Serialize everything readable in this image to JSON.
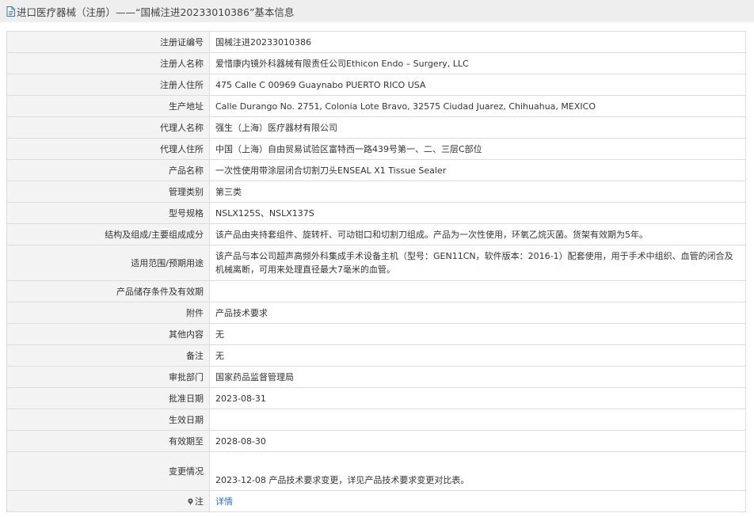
{
  "header": {
    "title": "进口医疗器械（注册）——“国械注进20233010386”基本信息"
  },
  "rows": [
    {
      "label": "注册证编号",
      "value": "国械注进20233010386"
    },
    {
      "label": "注册人名称",
      "value": "爱惜康内镜外科器械有限责任公司Ethicon Endo – Surgery, LLC"
    },
    {
      "label": "注册人住所",
      "value": "475 Calle C 00969 Guaynabo PUERTO RICO USA"
    },
    {
      "label": "生产地址",
      "value": "Calle Durango No. 2751, Colonia Lote Bravo, 32575 Ciudad Juarez, Chihuahua, MEXICO"
    },
    {
      "label": "代理人名称",
      "value": "强生（上海）医疗器材有限公司"
    },
    {
      "label": "代理人住所",
      "value": "中国（上海）自由贸易试验区富特西一路439号第一、二、三层C部位"
    },
    {
      "label": "产品名称",
      "value": "一次性使用带涂层闭合切割刀头ENSEAL X1 Tissue Sealer"
    },
    {
      "label": "管理类别",
      "value": "第三类"
    },
    {
      "label": "型号规格",
      "value": "NSLX125S、NSLX137S"
    },
    {
      "label": "结构及组成/主要组成成分",
      "value": "该产品由夹持套组件、旋转杆、可动钳口和切割刀组成。产品为一次性使用，环氧乙烷灭菌。货架有效期为5年。"
    },
    {
      "label": "适用范围/预期用途",
      "value": "该产品与本公司超声高频外科集成手术设备主机（型号：GEN11CN，软件版本：2016-1）配套使用，用于手术中组织、血管的闭合及机械离断，可用来处理直径最大7毫米的血管。"
    },
    {
      "label": "产品储存条件及有效期",
      "value": ""
    },
    {
      "label": "附件",
      "value": "产品技术要求"
    },
    {
      "label": "其他内容",
      "value": "无"
    },
    {
      "label": "备注",
      "value": "无"
    },
    {
      "label": "审批部门",
      "value": "国家药品监督管理局"
    },
    {
      "label": "批准日期",
      "value": "2023-08-31"
    },
    {
      "label": "生效日期",
      "value": ""
    },
    {
      "label": "有效期至",
      "value": "2028-08-30"
    },
    {
      "label": "变更情况",
      "value": "2023-12-08 产品技术要求变更，详见产品技术要求变更对比表。"
    }
  ],
  "note": {
    "label": "注",
    "link_text": "详情",
    "icon": "pin-icon"
  }
}
